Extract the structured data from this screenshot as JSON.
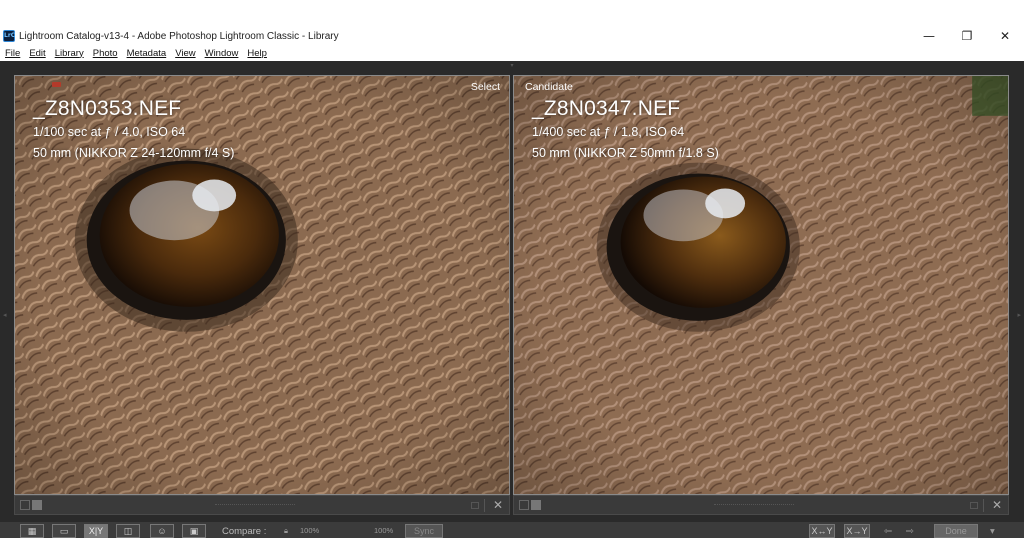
{
  "window": {
    "title": "Lightroom Catalog-v13-4 - Adobe Photoshop Lightroom Classic - Library",
    "app_icon_text": "LrC",
    "minimize_glyph": "—",
    "restore_glyph": "❐",
    "close_glyph": "✕"
  },
  "menu": [
    "File",
    "Edit",
    "Library",
    "Photo",
    "Metadata",
    "View",
    "Window",
    "Help"
  ],
  "panels": {
    "select": {
      "label": "Select",
      "filename": "_Z8N0353.NEF",
      "exposure": "1/100 sec at ƒ / 4.0, ISO 64",
      "lens": "50 mm (NIKKOR Z 24-120mm f/4 S)"
    },
    "candidate": {
      "label": "Candidate",
      "filename": "_Z8N0347.NEF",
      "exposure": "1/400 sec at ƒ / 1.8, ISO 64",
      "lens": "50 mm (NIKKOR Z 50mm f/1.8 S)"
    }
  },
  "strip": {
    "close_glyph": "✕"
  },
  "toolbar": {
    "compare_label": "Compare :",
    "zoom_left": "100%",
    "zoom_right": "100%",
    "sync_label": "Sync",
    "done_label": "Done",
    "xy_label": "X|Y",
    "swap_label": "X↔Y",
    "make_select_label": "X→Y",
    "prev_glyph": "⇦",
    "next_glyph": "⇨"
  },
  "colors": {
    "workspace": "#2a2a2a",
    "fur": "#8e6c52",
    "eye_iris": "#5a3510",
    "text_white": "#ffffff"
  }
}
